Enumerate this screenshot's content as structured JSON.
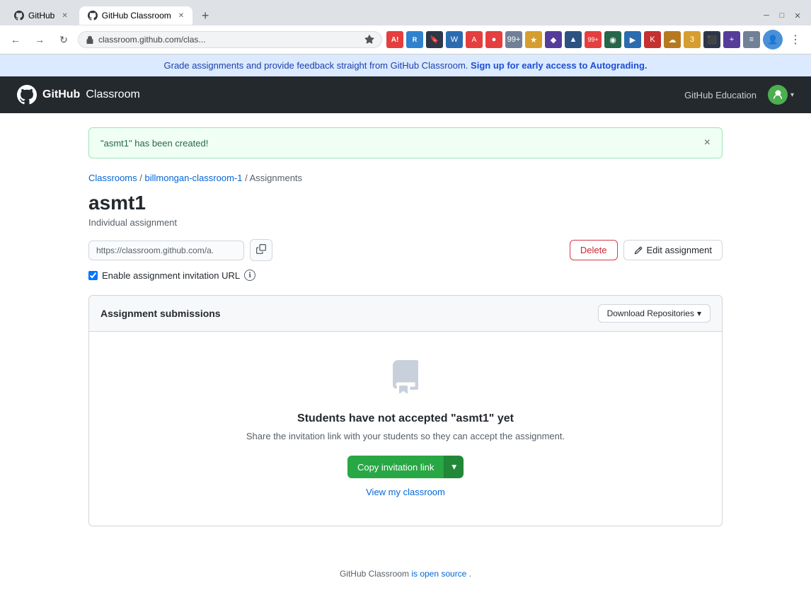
{
  "browser": {
    "tabs": [
      {
        "id": "tab-github",
        "label": "GitHub",
        "url": "github.com",
        "active": false
      },
      {
        "id": "tab-classroom",
        "label": "GitHub Classroom",
        "url": "classroom.github.com/clas...",
        "active": true
      }
    ],
    "address": "classroom.github.com/clas...",
    "new_tab_label": "+"
  },
  "notification_banner": {
    "text": "Grade assignments and provide feedback straight from GitHub Classroom.",
    "link_text": "Sign up for early access to Autograding.",
    "link_url": "#"
  },
  "nav": {
    "logo_bold": "GitHub",
    "logo_text": "Classroom",
    "edu_label": "GitHub Education",
    "avatar_alt": "User avatar"
  },
  "alert": {
    "message": "\"asmt1\" has been created!",
    "close_label": "×"
  },
  "breadcrumb": {
    "classrooms_label": "Classrooms",
    "classrooms_url": "#",
    "classroom_name": "billmongan-classroom-1",
    "classroom_url": "#",
    "section": "Assignments"
  },
  "assignment": {
    "title": "asmt1",
    "type": "Individual assignment",
    "url_value": "https://classroom.github.com/a.",
    "url_placeholder": "https://classroom.github.com/a.",
    "copy_tooltip": "Copy URL",
    "enable_url_label": "Enable assignment invitation URL",
    "enable_url_checked": true
  },
  "buttons": {
    "delete_label": "Delete",
    "edit_label": "Edit assignment",
    "download_label": "Download Repositories",
    "copy_invitation_label": "Copy invitation link",
    "view_classroom_label": "View my classroom"
  },
  "submissions": {
    "section_title": "Assignment submissions",
    "empty_icon": "📋",
    "empty_title": "Students have not accepted \"asmt1\" yet",
    "empty_subtitle": "Share the invitation link with your students so they can accept the assignment."
  },
  "footer": {
    "text": "GitHub Classroom",
    "link_text": "is open source",
    "link_url": "#",
    "period": "."
  }
}
